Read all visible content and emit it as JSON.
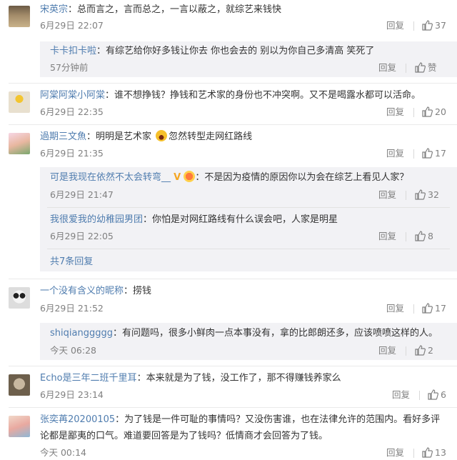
{
  "comments": [
    {
      "user": "宋英宗",
      "text": "：总而言之，言而总之，一言以蔽之，就综艺来钱快",
      "time": "6月29日 22:07",
      "reply_label": "回复",
      "likes": "37",
      "replies": [
        {
          "user": "卡卡扣卡啦",
          "text": "：有综艺给你好多钱让你去 你也会去的 别以为你自己多清高 笑死了",
          "time": "57分钟前",
          "reply_label": "回复",
          "likes": "赞"
        }
      ]
    },
    {
      "user": "阿棠阿棠小阿棠",
      "text": "：谁不想挣钱？挣钱和艺术家的身份也不冲突啊。又不是喝露水都可以活命。",
      "time": "6月29日 22:35",
      "reply_label": "回复",
      "likes": "20"
    },
    {
      "user": "過期三文魚",
      "text": "：明明是艺术家",
      "text2": "忽然转型走网红路线",
      "time": "6月29日 21:35",
      "reply_label": "回复",
      "likes": "17",
      "replies": [
        {
          "user": "可是我现在依然不太会转弯__",
          "text": "：不是因为疫情的原因你以为会在综艺上看见人家？",
          "time": "6月29日 21:47",
          "reply_label": "回复",
          "likes": "32"
        },
        {
          "user": "我很爱我的幼稚园男团",
          "text": "：你怕是对网红路线有什么误会吧，人家是明星",
          "time": "6月29日 22:05",
          "reply_label": "回复",
          "likes": "8"
        }
      ],
      "more_replies": "共7条回复"
    },
    {
      "user": "一个没有含义的昵称",
      "text": "：捞钱",
      "time": "6月29日 21:52",
      "reply_label": "回复",
      "likes": "17",
      "replies": [
        {
          "user": "shiqianggggg",
          "text": "：有问题吗，很多小鲜肉一点本事没有，拿的比郎朗还多，应该喷喷这样的人。",
          "time": "今天 06:28",
          "reply_label": "回复",
          "likes": "2"
        }
      ]
    },
    {
      "user": "Echo是三年二班千里耳",
      "text": "：本来就是为了钱，没工作了，那不得赚钱养家么",
      "time": "6月29日 23:14",
      "reply_label": "回复",
      "likes": "6"
    },
    {
      "user": "张奕苒20200105",
      "text": "：为了钱是一件可耻的事情吗？又没伤害谁，也在法律允许的范围内。看好多评",
      "text_line2": "论都是鄙夷的口气。难道要回答是为了钱吗？低情商才会回答为了钱。",
      "time": "今天 00:14",
      "reply_label": "回复",
      "likes": "13"
    }
  ],
  "colors": {
    "username": "#507daf",
    "text": "#333333",
    "meta": "#808080",
    "subbox": "#f2f2f5"
  }
}
